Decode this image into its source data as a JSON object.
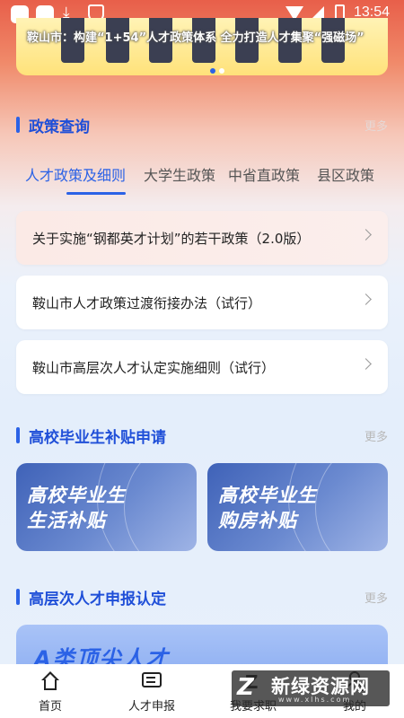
{
  "status_bar": {
    "time": "13:54",
    "download_glyph": "⤓"
  },
  "banner": {
    "title": "鞍山市：构建“1+54”人才政策体系 全力打造人才集聚“强磁场”"
  },
  "policy_section": {
    "title": "政策查询",
    "more": "更多",
    "tabs": [
      "人才政策及细则",
      "大学生政策",
      "中省直政策",
      "县区政策"
    ],
    "items": [
      "关于实施“钢都英才计划”的若干政策（2.0版）",
      "鞍山市人才政策过渡衔接办法（试行）",
      "鞍山市高层次人才认定实施细则（试行）"
    ]
  },
  "subsidy_section": {
    "title": "高校毕业生补贴申请",
    "more": "更多",
    "cards": [
      {
        "line1": "高校毕业生",
        "line2": "生活补贴"
      },
      {
        "line1": "高校毕业生",
        "line2": "购房补贴"
      }
    ]
  },
  "talent_section": {
    "title": "高层次人才申报认定",
    "more": "更多",
    "card_text": "A类顶尖人才"
  },
  "bottom_nav": {
    "items": [
      {
        "label": "首页",
        "icon": "home-icon"
      },
      {
        "label": "人才申报",
        "icon": "message-icon"
      },
      {
        "label": "我要求职",
        "icon": "job-icon"
      },
      {
        "label": "我的",
        "icon": "user-icon"
      }
    ]
  },
  "watermark": {
    "logo": "Z",
    "text": "新绿资源网",
    "sub": "www.xlhs.com"
  },
  "colors": {
    "accent": "#2b62e6",
    "title_blue": "#1f4fd8"
  }
}
